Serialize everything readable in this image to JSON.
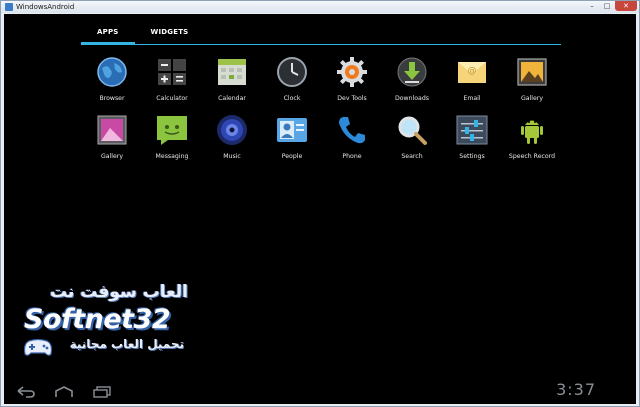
{
  "window": {
    "title": "WindowsAndroid"
  },
  "tabs": [
    {
      "label": "APPS",
      "active": true
    },
    {
      "label": "WIDGETS",
      "active": false
    }
  ],
  "apps": [
    {
      "label": "Browser",
      "icon": "globe-icon"
    },
    {
      "label": "Calculator",
      "icon": "calculator-icon"
    },
    {
      "label": "Calendar",
      "icon": "calendar-icon"
    },
    {
      "label": "Clock",
      "icon": "clock-icon"
    },
    {
      "label": "Dev Tools",
      "icon": "gear-icon"
    },
    {
      "label": "Downloads",
      "icon": "download-icon"
    },
    {
      "label": "Email",
      "icon": "envelope-icon"
    },
    {
      "label": "Gallery",
      "icon": "picture-icon"
    },
    {
      "label": "Gallery",
      "icon": "photo-frame-icon"
    },
    {
      "label": "Messaging",
      "icon": "chat-bubble-icon"
    },
    {
      "label": "Music",
      "icon": "speaker-icon"
    },
    {
      "label": "People",
      "icon": "contact-card-icon"
    },
    {
      "label": "Phone",
      "icon": "phone-handset-icon"
    },
    {
      "label": "Search",
      "icon": "magnifier-icon"
    },
    {
      "label": "Settings",
      "icon": "sliders-icon"
    },
    {
      "label": "Speech Record",
      "icon": "android-robot-icon"
    }
  ],
  "watermark": {
    "line1": "العاب سوفت نت",
    "line2": "Softnet32",
    "line3": "تحميل العاب مجانية"
  },
  "status": {
    "time": "3:37"
  },
  "colors": {
    "accent": "#33b5e5",
    "background": "#000000"
  }
}
